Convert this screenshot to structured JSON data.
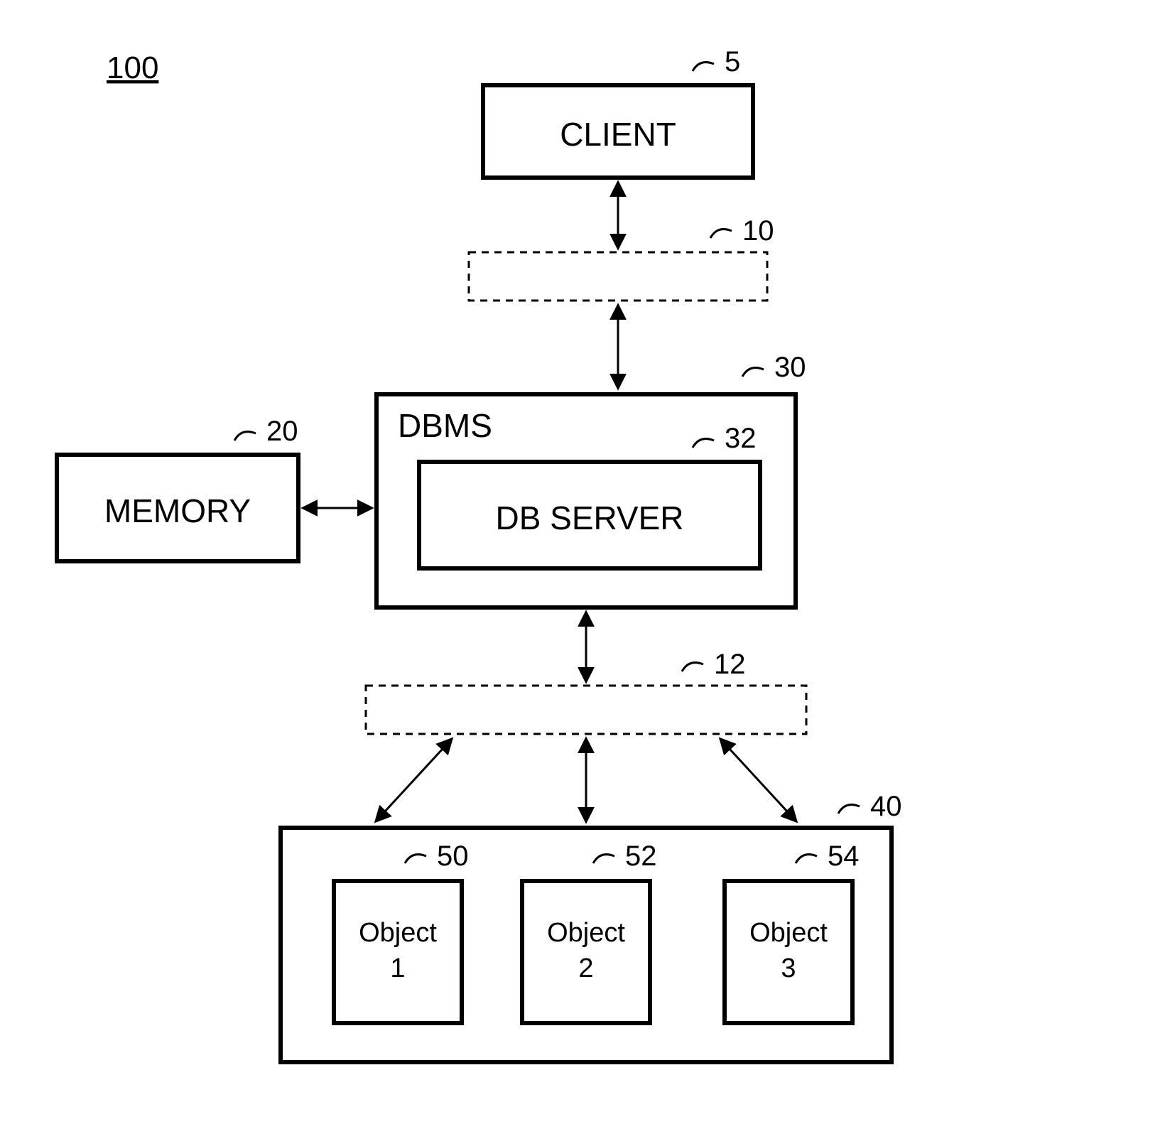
{
  "diagram_id": "100",
  "nodes": {
    "client": {
      "label": "CLIENT",
      "ref": "5"
    },
    "bus_top": {
      "label": "",
      "ref": "10"
    },
    "memory": {
      "label": "MEMORY",
      "ref": "20"
    },
    "dbms": {
      "label": "DBMS",
      "ref": "30"
    },
    "dbserver": {
      "label": "DB SERVER",
      "ref": "32"
    },
    "bus_bot": {
      "label": "",
      "ref": "12"
    },
    "storage": {
      "label": "",
      "ref": "40"
    },
    "obj1": {
      "label1": "Object",
      "label2": "1",
      "ref": "50"
    },
    "obj2": {
      "label1": "Object",
      "label2": "2",
      "ref": "52"
    },
    "obj3": {
      "label1": "Object",
      "label2": "3",
      "ref": "54"
    }
  }
}
